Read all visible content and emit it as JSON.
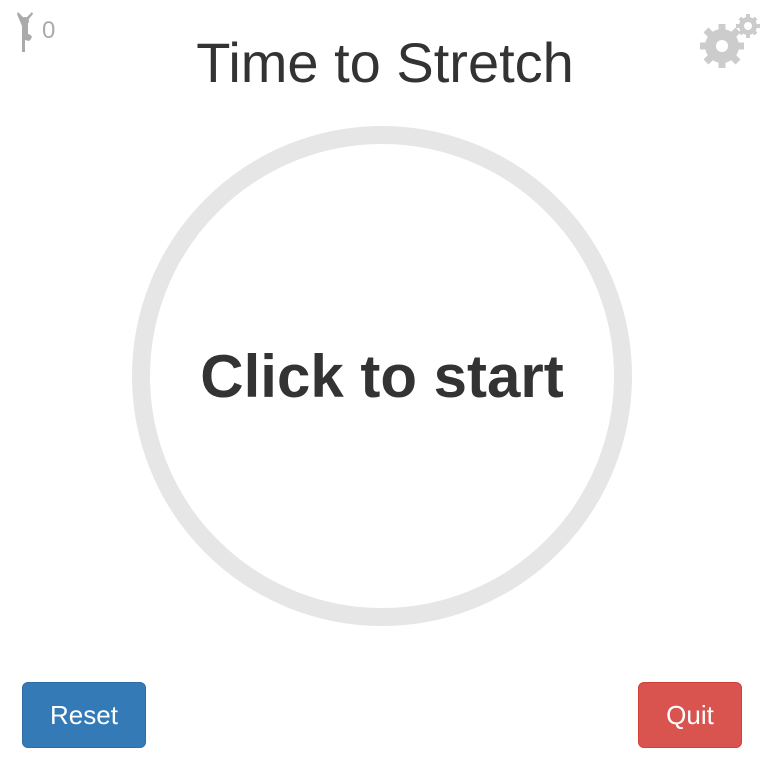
{
  "counter": {
    "icon": "yoga-pose-icon",
    "value": "0"
  },
  "settings": {
    "icon": "gears-icon"
  },
  "title": "Time to Stretch",
  "timer": {
    "label": "Click to start"
  },
  "buttons": {
    "reset": "Reset",
    "quit": "Quit"
  },
  "colors": {
    "reset": "#337ab7",
    "quit": "#d9534f",
    "ring": "#e6e6e6"
  }
}
